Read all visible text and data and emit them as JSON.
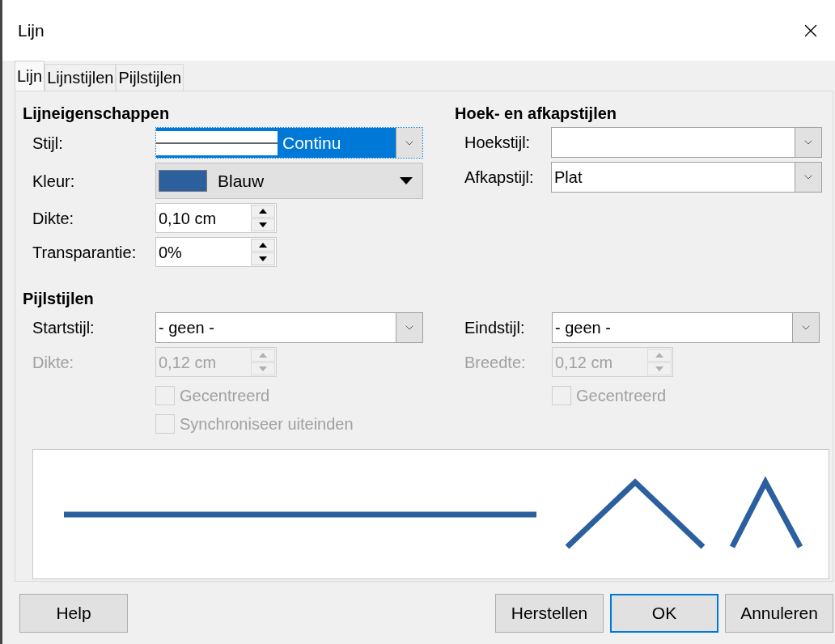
{
  "window": {
    "title": "Lijn"
  },
  "tabs": [
    {
      "label": "Lijn",
      "selected": true
    },
    {
      "label": "Lijnstijlen",
      "selected": false
    },
    {
      "label": "Pijlstijlen",
      "selected": false
    }
  ],
  "line_properties": {
    "heading": "Lijneigenschappen",
    "style": {
      "label": "Stijl:",
      "value": "Continu",
      "focused": true
    },
    "color": {
      "label": "Kleur:",
      "value": "Blauw",
      "color": "#2c5f9e"
    },
    "width": {
      "label": "Dikte:",
      "value": "0,10 cm"
    },
    "transparency": {
      "label": "Transparantie:",
      "value": "0%"
    }
  },
  "corner_cap": {
    "heading": "Hoek- en afkapstijlen",
    "corner": {
      "label": "Hoekstijl:"
    },
    "cap": {
      "label": "Afkapstijl:",
      "value": "Plat"
    }
  },
  "arrow_styles": {
    "heading": "Pijlstijlen",
    "start": {
      "style": {
        "label": "Startstijl:",
        "value": "- geen -"
      },
      "size": {
        "label": "Dikte:",
        "value": "0,12 cm",
        "disabled": true
      },
      "checkboxes": [
        {
          "label": "Gecentreerd",
          "checked": false,
          "disabled": true
        },
        {
          "label": "Synchroniseer uiteinden",
          "checked": false,
          "disabled": true
        }
      ]
    },
    "end": {
      "style": {
        "label": "Eindstijl:",
        "value": "- geen -"
      },
      "size": {
        "label": "Breedte:",
        "value": "0,12 cm",
        "disabled": true
      },
      "checkboxes": [
        {
          "label": "Gecentreerd",
          "checked": false,
          "disabled": true
        }
      ]
    }
  },
  "buttons": [
    {
      "label": "Help",
      "default": false
    },
    {
      "label": "Herstellen",
      "default": false
    },
    {
      "label": "OK",
      "default": true
    },
    {
      "label": "Annuleren",
      "default": false
    }
  ]
}
